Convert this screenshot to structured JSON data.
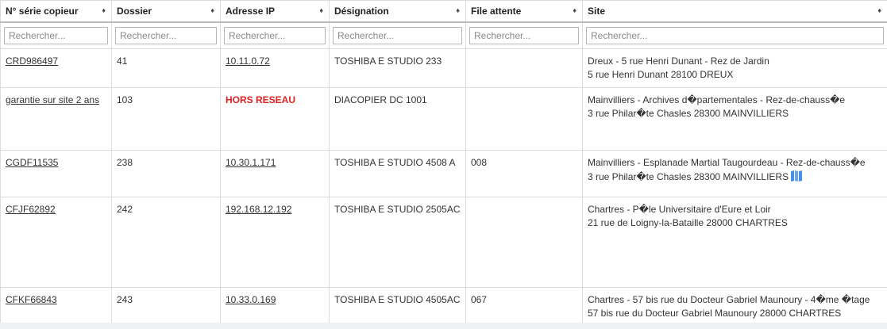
{
  "headers": [
    {
      "label": "N° série copieur"
    },
    {
      "label": "Dossier"
    },
    {
      "label": "Adresse IP"
    },
    {
      "label": "Désignation"
    },
    {
      "label": "File attente"
    },
    {
      "label": "Site"
    }
  ],
  "sort_icon": "sort-arrows-icon",
  "search_placeholder": "Rechercher...",
  "rows": [
    {
      "serie": "CRD986497",
      "dossier": "41",
      "ip": "10.11.0.72",
      "designation": "TOSHIBA E STUDIO 233",
      "file": "",
      "site_line1": "Dreux - 5 rue Henri Dunant - Rez de Jardin",
      "site_line2": "5 rue Henri Dunant 28100 DREUX"
    },
    {
      "serie": "garantie sur site 2 ans",
      "dossier": "103",
      "ip": "HORS RESEAU",
      "designation": "DIACOPIER DC 1001",
      "file": "",
      "site_line1": "Mainvilliers - Archives d�partementales - Rez-de-chauss�e",
      "site_line2": "3 rue Philar�te Chasles 28300 MAINVILLIERS"
    },
    {
      "serie": "CGDF11535",
      "dossier": "238",
      "ip": "10.30.1.171",
      "designation": "TOSHIBA E STUDIO 4508 A",
      "file": "008",
      "site_line1": "Mainvilliers - Esplanade Martial Taugourdeau - Rez-de-chauss�e",
      "site_line2": "3 rue Philar�te Chasles 28300 MAINVILLIERS"
    },
    {
      "serie": "CFJF62892",
      "dossier": "242",
      "ip": "192.168.12.192",
      "designation": "TOSHIBA E STUDIO 2505AC",
      "file": "",
      "site_line1": "Chartres - P�le Universitaire d'Eure et Loir",
      "site_line2": "21 rue de Loigny-la-Bataille 28000 CHARTRES"
    },
    {
      "serie": "CFKF66843",
      "dossier": "243",
      "ip": "10.33.0.169",
      "designation": "TOSHIBA E STUDIO 4505AC",
      "file": "067",
      "site_line1": "Chartres - 57 bis rue du Docteur Gabriel Maunoury - 4�me �tage",
      "site_line2": "57 bis rue du Docteur Gabriel Maunoury 28000 CHARTRES"
    }
  ],
  "colors": {
    "offline": "#e02020",
    "map_icon": "#4a90e2"
  },
  "map_icon": "map-icon"
}
